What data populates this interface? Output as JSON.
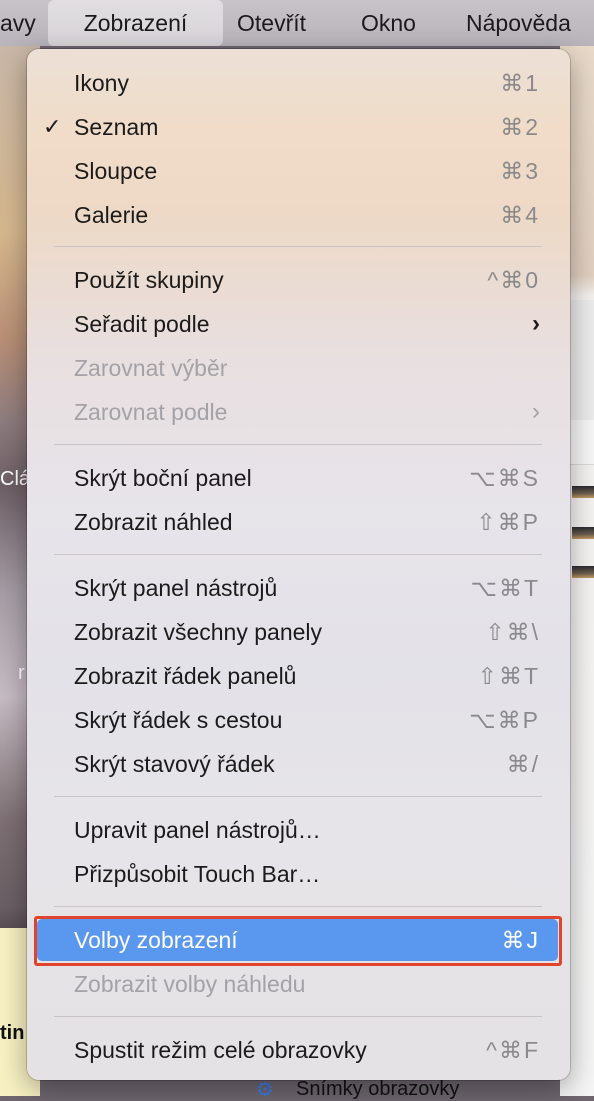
{
  "menubar": {
    "items": [
      {
        "label": "avy"
      },
      {
        "label": "Zobrazení",
        "active": true
      },
      {
        "label": "Otevřít"
      },
      {
        "label": "Okno"
      },
      {
        "label": "Nápověda"
      }
    ]
  },
  "background": {
    "left_text_1": "Clá",
    "left_text_2": "r",
    "left_text_3": "tin",
    "bottom_text": "Snímky obrazovky"
  },
  "menu": {
    "items": [
      {
        "label": "Ikony",
        "shortcut": "⌘1"
      },
      {
        "label": "Seznam",
        "shortcut": "⌘2",
        "checked": true
      },
      {
        "label": "Sloupce",
        "shortcut": "⌘3"
      },
      {
        "label": "Galerie",
        "shortcut": "⌘4"
      },
      {
        "label": "Použít skupiny",
        "shortcut": "^⌘0"
      },
      {
        "label": "Seřadit podle",
        "submenu": true
      },
      {
        "label": "Zarovnat výběr",
        "disabled": true
      },
      {
        "label": "Zarovnat podle",
        "submenu": true,
        "disabled": true
      },
      {
        "label": "Skrýt boční panel",
        "shortcut": "⌥⌘S"
      },
      {
        "label": "Zobrazit náhled",
        "shortcut": "⇧⌘P"
      },
      {
        "label": "Skrýt panel nástrojů",
        "shortcut": "⌥⌘T"
      },
      {
        "label": "Zobrazit všechny panely",
        "shortcut": "⇧⌘\\"
      },
      {
        "label": "Zobrazit řádek panelů",
        "shortcut": "⇧⌘T"
      },
      {
        "label": "Skrýt řádek s cestou",
        "shortcut": "⌥⌘P"
      },
      {
        "label": "Skrýt stavový řádek",
        "shortcut": "⌘/"
      },
      {
        "label": "Upravit panel nástrojů…"
      },
      {
        "label": "Přizpůsobit Touch Bar…"
      },
      {
        "label": "Volby zobrazení",
        "shortcut": "⌘J",
        "selected": true
      },
      {
        "label": "Zobrazit volby náhledu",
        "disabled": true
      },
      {
        "label": "Spustit režim celé obrazovky",
        "shortcut": "^⌘F"
      }
    ],
    "checkmark": "✓",
    "submenu_glyph": "›"
  },
  "colors": {
    "highlight": "#5a97ef",
    "annotation_box": "#e0442c",
    "disabled_text": "#a4a2a6"
  }
}
